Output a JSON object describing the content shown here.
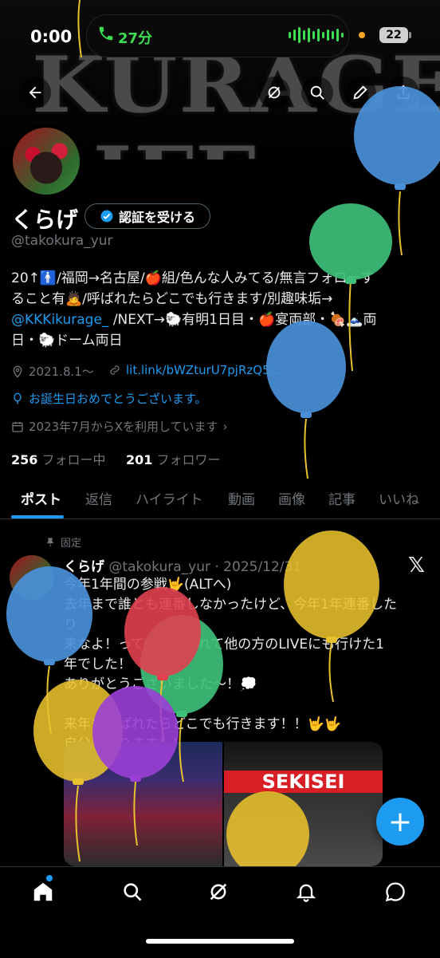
{
  "status_bar": {
    "time": "0:00",
    "call_duration": "27分",
    "battery": "22"
  },
  "banner": {
    "text": "KURAGE LIFE"
  },
  "profile": {
    "display_name": "くらげ",
    "verify_button": "認証を受ける",
    "handle": "@takokura_yur",
    "bio_line1": "20↑🚹/福岡→名古屋/🍎組/色んな人みてる/無言フォローす",
    "bio_line2": "ること有🙇/呼ばれたらどこでも行きます/別趣味垢→",
    "bio_mention": "@KKKikurage_",
    "bio_line3_rest": " /NEXT→🐑有明1日目・🍎宴両部・🍖🗻両",
    "bio_line4": "日・🐑ドーム両日",
    "birth_date": "2021.8.1～",
    "link": "lit.link/bWZturU7pjRzQ5...",
    "birthday_message": "お誕生日おめでとうございます。",
    "joined": "2023年7月からXを利用しています",
    "following_count": "256",
    "following_label": "フォロー中",
    "followers_count": "201",
    "followers_label": "フォロワー"
  },
  "tabs": [
    "ポスト",
    "返信",
    "ハイライト",
    "動画",
    "画像",
    "記事",
    "いいね"
  ],
  "post": {
    "pinned_label": "固定",
    "author_name": "くらげ",
    "author_handle": "@takokura_yur",
    "date": "· 2025/12/31",
    "lines": [
      "今年1年間の参戦🤟(ALTへ)",
      "去年まで誰とも連番しなかったけど、今年1年連番したり",
      "来なよ！って言ってくれて他の方のLIVEにも行けた1",
      "年でした！",
      "ありがとうございました～！💭",
      "",
      "来年も呼ばれたらどこでも行きます！！🤟🤟",
      "自分も誘ります！！"
    ],
    "media_right_text": "SEKISEI"
  },
  "colors": {
    "accent": "#1d9bf0",
    "balloon_blue": "#4a90d9",
    "balloon_green": "#3fbf7a",
    "balloon_yellow": "#e8c22e",
    "balloon_red": "#e0414f",
    "balloon_purple": "#9b3fd6"
  }
}
